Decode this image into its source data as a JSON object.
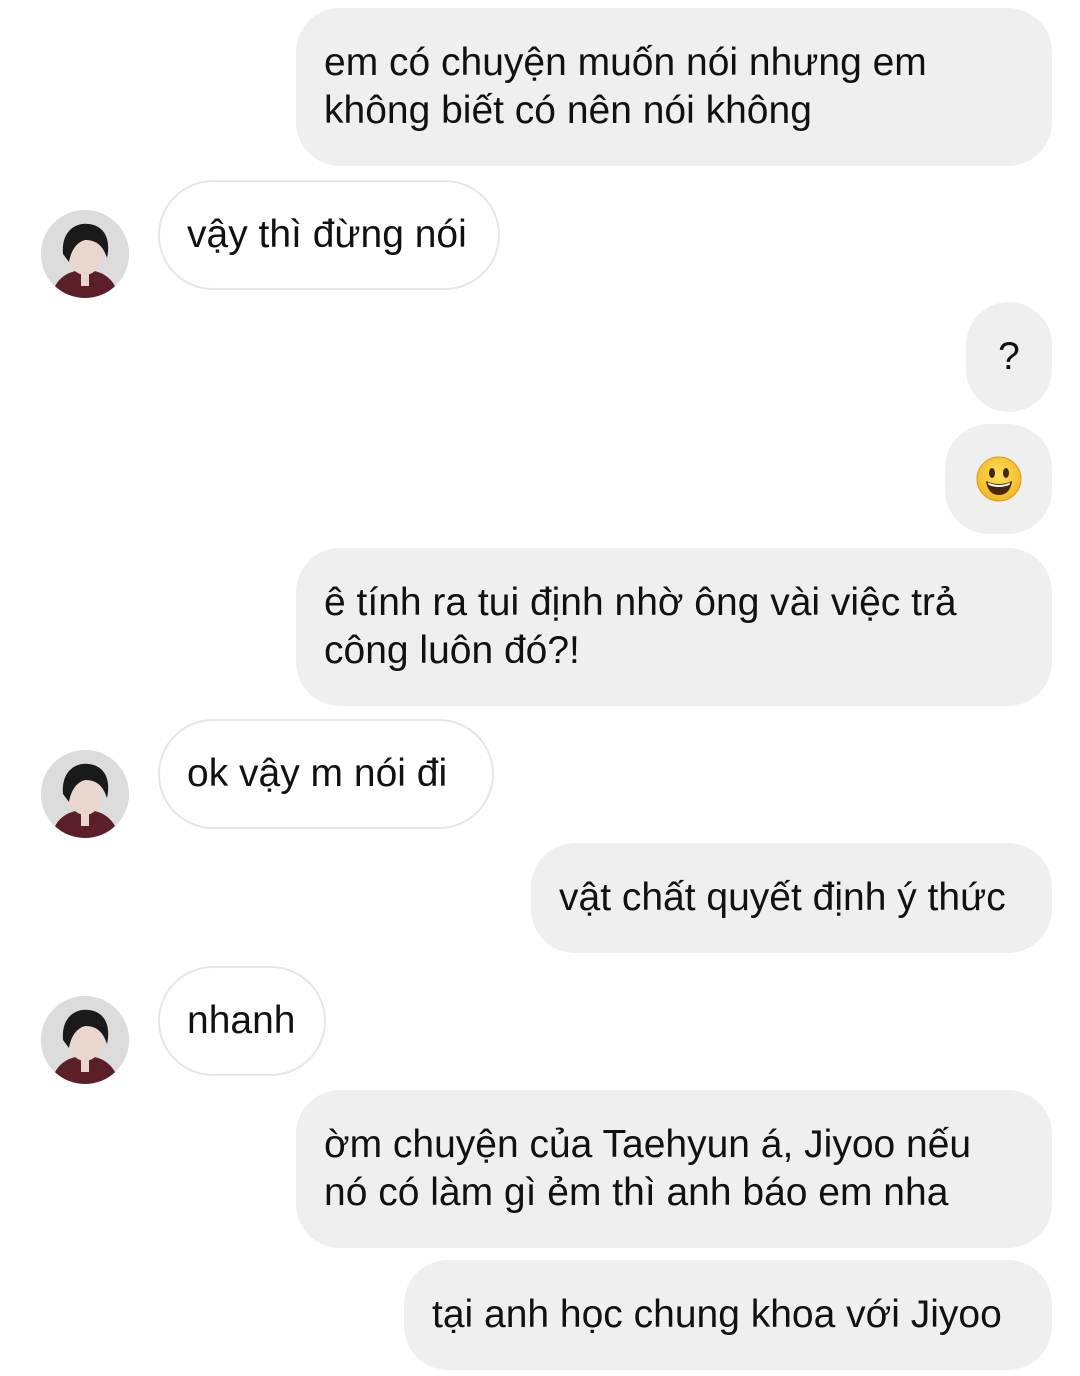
{
  "conversation": {
    "messages": [
      {
        "from": "me",
        "text": "em có chuyện muốn nói nhưng em\nkhông biết có nên nói không"
      },
      {
        "from": "contact",
        "text": "vậy thì đừng nói"
      },
      {
        "from": "me",
        "text": "?"
      },
      {
        "from": "me",
        "emoji": "grinning-face"
      },
      {
        "from": "me",
        "text": "ê tính ra tui định nhờ ông vài việc trả\ncông luôn đó?!"
      },
      {
        "from": "contact",
        "text": "ok vậy m nói đi"
      },
      {
        "from": "me",
        "text": "vật chất quyết định ý thức"
      },
      {
        "from": "contact",
        "text": "nhanh"
      },
      {
        "from": "me",
        "text": "ờm chuyện của Taehyun á, Jiyoo nếu\nnó có làm gì ẻm thì anh báo em nha"
      },
      {
        "from": "me",
        "text": "tại anh học chung khoa với Jiyoo"
      }
    ]
  },
  "colors": {
    "sent_bubble": "#efefef",
    "received_bubble_border": "#e6e6e6",
    "text": "#111111",
    "emoji_face": "#f7c531"
  }
}
